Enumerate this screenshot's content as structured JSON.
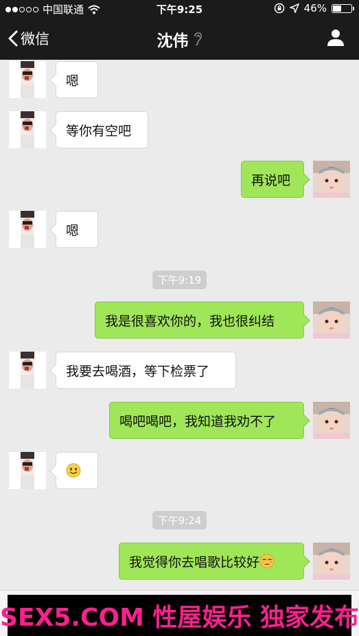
{
  "status_bar": {
    "carrier": "中国联通",
    "time": "下午9:25",
    "battery": "46%",
    "battery_level": 0.46,
    "signal_bars_filled": 2,
    "signal_bars_total": 5
  },
  "nav": {
    "back_label": "微信",
    "title": "沈伟",
    "title_icon": "earpiece-icon",
    "right_icon": "profile-icon"
  },
  "messages": [
    {
      "side": "in",
      "text": "嗯"
    },
    {
      "side": "in",
      "text": "等你有空吧"
    },
    {
      "side": "out",
      "text": "再说吧"
    },
    {
      "side": "in",
      "text": "嗯"
    },
    {
      "timestamp": "下午9:19"
    },
    {
      "side": "out",
      "text": "我是很喜欢你的，我也很纠结"
    },
    {
      "side": "in",
      "text": "我要去喝酒，等下检票了"
    },
    {
      "side": "out",
      "text": "喝吧喝吧，我知道我劝不了"
    },
    {
      "side": "in",
      "text": "",
      "emoji": "smile-emoji"
    },
    {
      "timestamp": "下午9:24"
    },
    {
      "side": "out",
      "text": "我觉得你去唱歌比较好",
      "emoji": "unamused-emoji"
    }
  ],
  "watermark": "SEX5.COM 性屋娱乐 独家发布",
  "colors": {
    "bar_bg": "#1b1b1c",
    "chat_bg": "#ebebeb",
    "out_bubble": "#9fe658",
    "in_bubble": "#ffffff",
    "watermark_text": "#ff1f8f"
  }
}
